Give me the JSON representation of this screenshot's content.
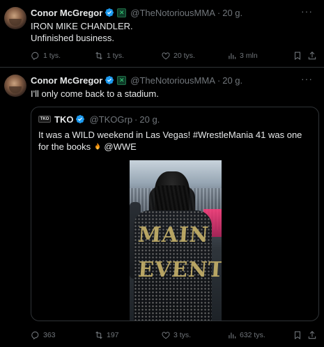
{
  "tweets": [
    {
      "author": "Conor McGregor",
      "handle": "@TheNotoriousMMA",
      "time": "20 g.",
      "lines": [
        "IRON MIKE CHANDLER.",
        "Unfinished business."
      ],
      "stats": {
        "replies": "1 tys.",
        "reposts": "1 tys.",
        "likes": "20 tys.",
        "views": "3 mln"
      }
    },
    {
      "author": "Conor McGregor",
      "handle": "@TheNotoriousMMA",
      "time": "20 g.",
      "lines": [
        "I'll only come back to a stadium."
      ],
      "stats": {
        "replies": "363",
        "reposts": "197",
        "likes": "3 tys.",
        "views": "632 tys."
      },
      "quote": {
        "logo": "TKO",
        "author": "TKO",
        "handle": "@TKOGrp",
        "time": "20 g.",
        "text": "It was a WILD weekend in Las Vegas! #WrestleMania 41 was one for the books",
        "text_after_emoji": "@WWE",
        "media_text_top": "MAIN",
        "media_text_bottom": "EVENT"
      }
    }
  ],
  "separator": "·",
  "colors": {
    "verified": "#1d9bf0",
    "muted": "#71767b",
    "border": "#2f3336",
    "text": "#e7e9ea"
  }
}
